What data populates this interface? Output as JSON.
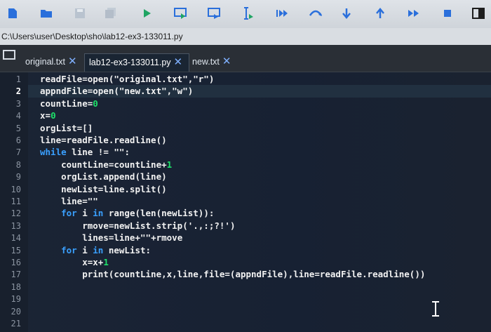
{
  "toolbar": {
    "icons": [
      "new-file-icon",
      "open-folder-icon",
      "save-icon",
      "save-all-icon",
      "run-icon",
      "run-module-icon",
      "debug-icon",
      "step-icon",
      "resume-icon",
      "step-over-icon",
      "step-into-icon",
      "step-out-icon",
      "fast-forward-icon",
      "stop-icon",
      "toggle-panel-icon"
    ],
    "accent": "#1e90ff"
  },
  "path": "C:\\Users\\user\\Desktop\\sho\\lab12-ex3-133011.py",
  "tabs": [
    {
      "label": "original.txt",
      "active": false
    },
    {
      "label": "lab12-ex3-133011.py",
      "active": true
    },
    {
      "label": "new.txt",
      "active": false
    }
  ],
  "editor": {
    "active_line": 2,
    "line_numbers": [
      "1",
      "2",
      "3",
      "4",
      "5",
      "6",
      "7",
      "8",
      "9",
      "10",
      "11",
      "12",
      "13",
      "14",
      "15",
      "16",
      "17",
      "18",
      "19",
      "20",
      "21"
    ],
    "lines": [
      "readFile=open(\"original.txt\",\"r\")",
      "appndFile=open(\"new.txt\",\"w\")",
      "countLine=0",
      "x=0",
      "orgList=[]",
      "line=readFile.readline()",
      "while line != \"\":",
      "    countLine=countLine+1",
      "    orgList.append(line)",
      "    newList=line.split()",
      "    line=\"\"",
      "    for i in range(len(newList)):",
      "        rmove=newList.strip('.,:;?!')",
      "        lines=line+\"\"+rmove",
      "    for i in newList:",
      "        x=x+1",
      "        print(countLine,x,line,file=(appndFile),line=readFile.readline())",
      "",
      "",
      "",
      ""
    ]
  },
  "colors": {
    "keyword": "#3aa0ff",
    "number": "#1ee06a",
    "text": "#f2f2f2",
    "background": "#1a2533"
  }
}
